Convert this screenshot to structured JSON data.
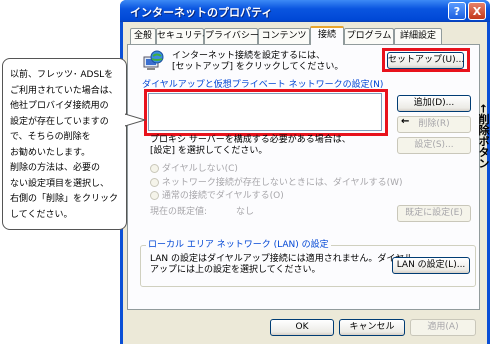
{
  "window": {
    "title": "インターネットのプロパティ",
    "help": "?",
    "close": "X"
  },
  "tabs": [
    "全般",
    "セキュリティ",
    "プライバシー",
    "コンテンツ",
    "接続",
    "プログラム",
    "詳細設定"
  ],
  "setup": {
    "text": "インターネット接続を設定するには、\n[セットアップ] をクリックしてください。",
    "button": "セットアップ(U)..."
  },
  "dialup": {
    "heading": "ダイヤルアップと仮想プライベート ネットワークの設定(N)",
    "add": "追加(D)...",
    "remove": "削除(R)",
    "settings": "設定(S)...",
    "proxy_text": "プロキシ サーバーを構成する必要がある場合は、\n[設定] を選択してください。",
    "radio1": "ダイヤルしない(C)",
    "radio2": "ネットワーク接続が存在しないときには、ダイヤルする(W)",
    "radio3": "通常の接続でダイヤルする(O)",
    "current_label": "現在の既定値:",
    "current_value": "なし",
    "default_btn": "既定に設定(E)"
  },
  "lan": {
    "heading": "ローカル エリア ネットワーク (LAN) の設定",
    "text": "LAN の設定はダイヤルアップ接続には適用されません。ダイヤル\nアップには上の設定を選択してください。",
    "button": "LAN の設定(L)..."
  },
  "footer": {
    "ok": "OK",
    "cancel": "キャンセル",
    "apply": "適用(A)"
  },
  "callout": {
    "text": "以前、フレッツ･ ADSLを\nご利用されていた場合は、\n他社プロバイダ接続用の\n設定が存在していますの\nで、そちらの削除を\nお勧めいたします。\n削除の方法は、必要の\nない設定項目を選択し、\n右側の「削除」をクリック\nしてください。"
  },
  "side_label": "←削除ボタン",
  "colors": {
    "highlight": "#e8121c",
    "titlebar": "#0a55e0",
    "dialog": "#ece9d8"
  }
}
